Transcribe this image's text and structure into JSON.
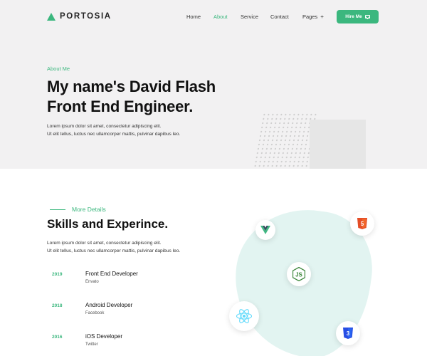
{
  "brand": {
    "name": "PORTOSIA"
  },
  "nav": {
    "items": [
      {
        "label": "Home",
        "active": false
      },
      {
        "label": "About",
        "active": true
      },
      {
        "label": "Service",
        "active": false
      },
      {
        "label": "Contact",
        "active": false
      },
      {
        "label": "Pages",
        "active": false
      }
    ],
    "pages_plus": "+",
    "cta_label": "Hire Me"
  },
  "hero": {
    "eyebrow": "About Me",
    "title_line1": "My name's David Flash",
    "title_line2": "Front End Engineer.",
    "text_line1": "Lorem ipsum dolor sit amet, consectetur adipiscing elit.",
    "text_line2": "Ut elit tellus, luctus nec ullamcorper mattis, pulvinar dapibus leo."
  },
  "skills": {
    "eyebrow": "More Details",
    "title": "Skills and Experince.",
    "text_line1": "Lorem ipsum dolor sit amet, consectetur adipiscing elit.",
    "text_line2": "Ut elit tellus, luctus nec ullamcorper mattis, pulvinar dapibus leo.",
    "experience": [
      {
        "year": "2019",
        "title": "Front End Developer",
        "company": "Envato"
      },
      {
        "year": "2018",
        "title": "Android Developer",
        "company": "Facebook"
      },
      {
        "year": "2016",
        "title": "iOS Developer",
        "company": "Twitter"
      }
    ]
  },
  "tech_icons": [
    "vue-icon",
    "html5-icon",
    "nodejs-icon",
    "react-icon",
    "css3-icon"
  ],
  "colors": {
    "accent": "#3bb77e",
    "hero_bg": "#f2f1f2",
    "blob": "#e2f4f1"
  }
}
